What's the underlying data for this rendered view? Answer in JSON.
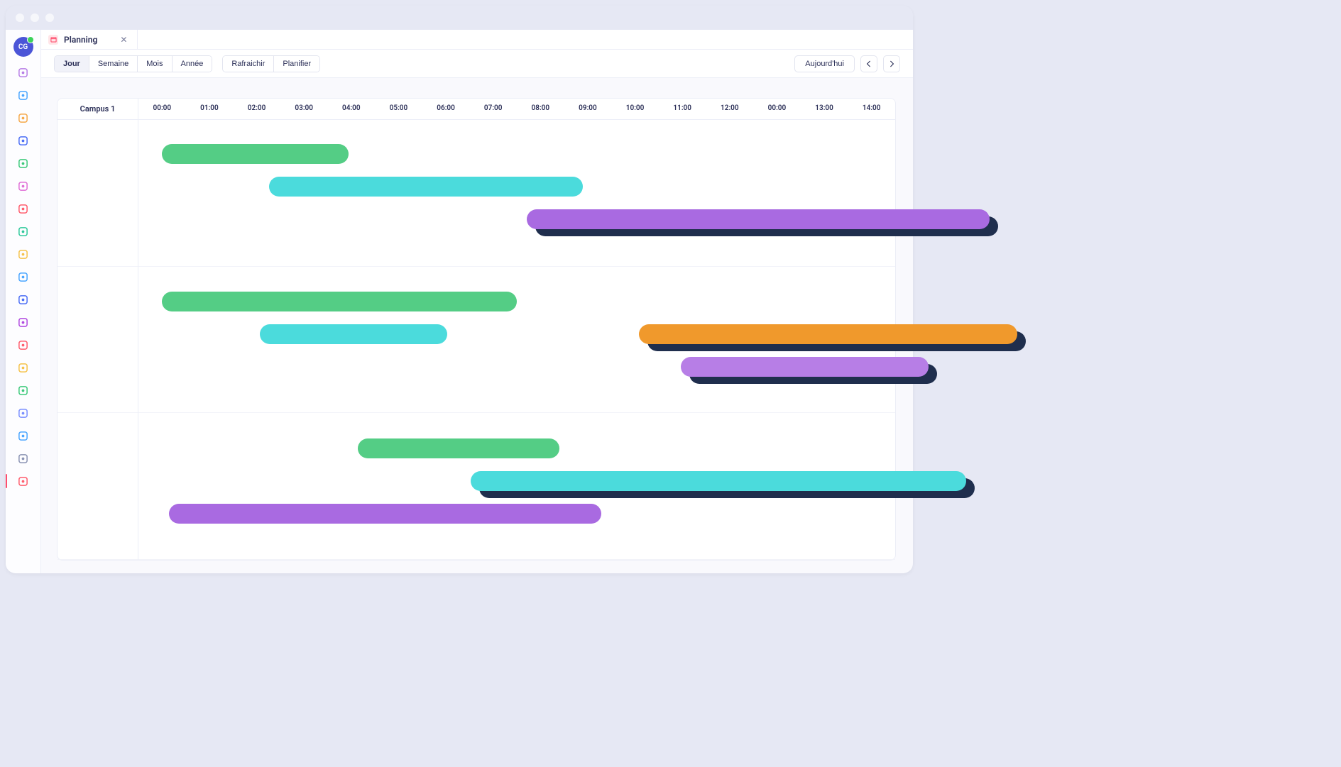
{
  "window": {
    "avatar_initials": "CG"
  },
  "tab": {
    "title": "Planning"
  },
  "toolbar": {
    "view_buttons": [
      "Jour",
      "Semaine",
      "Mois",
      "Année"
    ],
    "active_view": 0,
    "action_buttons": [
      "Rafraichir",
      "Planifier"
    ],
    "today_label": "Aujourd'hui"
  },
  "timeline": {
    "row_header": "Campus 1",
    "hours": [
      "00:00",
      "01:00",
      "02:00",
      "03:00",
      "04:00",
      "05:00",
      "06:00",
      "07:00",
      "08:00",
      "09:00",
      "10:00",
      "11:00",
      "12:00",
      "00:00",
      "13:00",
      "14:00"
    ],
    "rows": 3,
    "bars": [
      {
        "row": 0,
        "lane": 0,
        "start": 0.3,
        "end": 4.3,
        "color": "#54cd85"
      },
      {
        "row": 0,
        "lane": 1,
        "start": 2.6,
        "end": 9.3,
        "color": "#4bdbdc"
      },
      {
        "row": 0,
        "lane": 2,
        "start": 8.1,
        "end": 18.0,
        "color": "#a96ae1",
        "overflow": true
      },
      {
        "row": 1,
        "lane": 0,
        "start": 0.3,
        "end": 7.9,
        "color": "#54cd85"
      },
      {
        "row": 1,
        "lane": 1,
        "start": 2.4,
        "end": 6.4,
        "color": "#4bdbdc"
      },
      {
        "row": 1,
        "lane": 1,
        "start": 10.5,
        "end": 18.6,
        "color": "#f0992c",
        "overflow": true
      },
      {
        "row": 1,
        "lane": 2,
        "start": 11.4,
        "end": 16.7,
        "color": "#b77ee6",
        "overflow": true
      },
      {
        "row": 2,
        "lane": 0,
        "start": 4.5,
        "end": 8.8,
        "color": "#54cd85"
      },
      {
        "row": 2,
        "lane": 1,
        "start": 6.9,
        "end": 17.5,
        "color": "#4bdbdc",
        "overflow": true
      },
      {
        "row": 2,
        "lane": 2,
        "start": 0.45,
        "end": 9.7,
        "color": "#a96ae1"
      }
    ]
  },
  "sidebar_icons": [
    {
      "name": "users-icon",
      "color": "#b77ee6"
    },
    {
      "name": "folder-icon",
      "color": "#4aa6ff"
    },
    {
      "name": "trend-icon",
      "color": "#f5a94a"
    },
    {
      "name": "barbell-icon",
      "color": "#4b6ef5"
    },
    {
      "name": "chart-icon",
      "color": "#3cc97a"
    },
    {
      "name": "cart-icon",
      "color": "#e06fd6"
    },
    {
      "name": "block-icon",
      "color": "#ff5d6d"
    },
    {
      "name": "briefcase-icon",
      "color": "#2ec99b"
    },
    {
      "name": "doc-icon",
      "color": "#f5c24a"
    },
    {
      "name": "phone-icon",
      "color": "#4aa6ff"
    },
    {
      "name": "bot-icon",
      "color": "#4b6ef5"
    },
    {
      "name": "cube-icon",
      "color": "#b14ae0"
    },
    {
      "name": "gear-icon",
      "color": "#ff5d6d"
    },
    {
      "name": "car-icon",
      "color": "#f5c24a"
    },
    {
      "name": "comment-icon",
      "color": "#3cc97a"
    },
    {
      "name": "user-icon",
      "color": "#7a8fff"
    },
    {
      "name": "building-icon",
      "color": "#4aa6ff"
    },
    {
      "name": "fork-icon",
      "color": "#8a93b3"
    },
    {
      "name": "planning-icon",
      "color": "#ff5d6d",
      "active": true
    }
  ],
  "chart_data": {
    "type": "gantt",
    "x_unit": "hours",
    "x_ticks": [
      "00:00",
      "01:00",
      "02:00",
      "03:00",
      "04:00",
      "05:00",
      "06:00",
      "07:00",
      "08:00",
      "09:00",
      "10:00",
      "11:00",
      "12:00",
      "00:00",
      "13:00",
      "14:00"
    ],
    "resources": [
      "Campus 1"
    ],
    "rows": 3,
    "events": [
      {
        "row": 0,
        "start": 0.3,
        "end": 4.3,
        "series": "green"
      },
      {
        "row": 0,
        "start": 2.6,
        "end": 9.3,
        "series": "teal"
      },
      {
        "row": 0,
        "start": 8.1,
        "end": 18.0,
        "series": "purple",
        "extends_past_view": true
      },
      {
        "row": 1,
        "start": 0.3,
        "end": 7.9,
        "series": "green"
      },
      {
        "row": 1,
        "start": 2.4,
        "end": 6.4,
        "series": "teal"
      },
      {
        "row": 1,
        "start": 10.5,
        "end": 18.6,
        "series": "orange",
        "extends_past_view": true
      },
      {
        "row": 1,
        "start": 11.4,
        "end": 16.7,
        "series": "purple",
        "extends_past_view": true
      },
      {
        "row": 2,
        "start": 4.5,
        "end": 8.8,
        "series": "green"
      },
      {
        "row": 2,
        "start": 6.9,
        "end": 17.5,
        "series": "teal",
        "extends_past_view": true
      },
      {
        "row": 2,
        "start": 0.45,
        "end": 9.7,
        "series": "purple"
      }
    ],
    "series_colors": {
      "green": "#54cd85",
      "teal": "#4bdbdc",
      "purple": "#a96ae1",
      "orange": "#f0992c"
    }
  }
}
